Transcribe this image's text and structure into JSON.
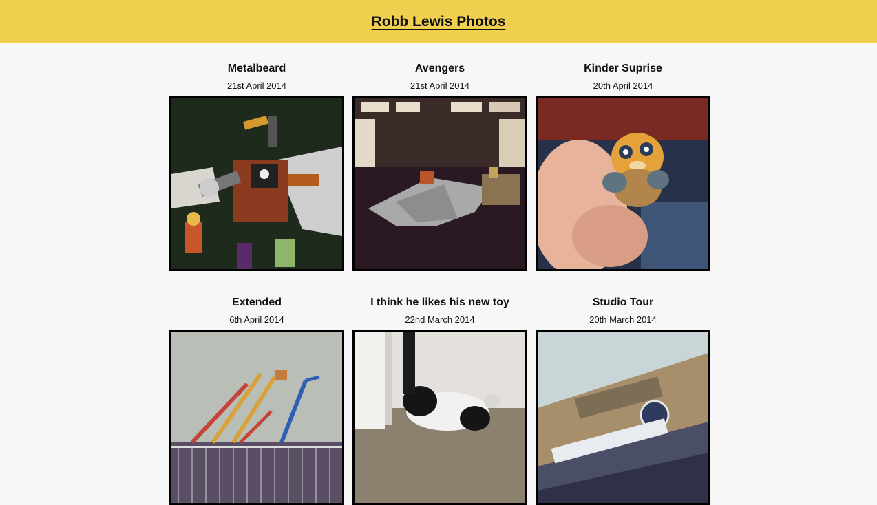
{
  "header": {
    "title": "Robb Lewis Photos"
  },
  "photos": [
    {
      "title": "Metalbeard",
      "date": "21st April 2014",
      "image": "lego-pirate-robot-photo"
    },
    {
      "title": "Avengers",
      "date": "21st April 2014",
      "image": "lego-jet-photo"
    },
    {
      "title": "Kinder Suprise",
      "date": "20th April 2014",
      "image": "toy-bird-in-hand-photo"
    },
    {
      "title": "Extended",
      "date": "6th April 2014",
      "image": "cherry-pickers-photo"
    },
    {
      "title": "I think he likes his new toy",
      "date": "22nd March 2014",
      "image": "cat-on-floor-photo"
    },
    {
      "title": "Studio Tour",
      "date": "20th March 2014",
      "image": "warner-bros-studio-photo"
    }
  ]
}
